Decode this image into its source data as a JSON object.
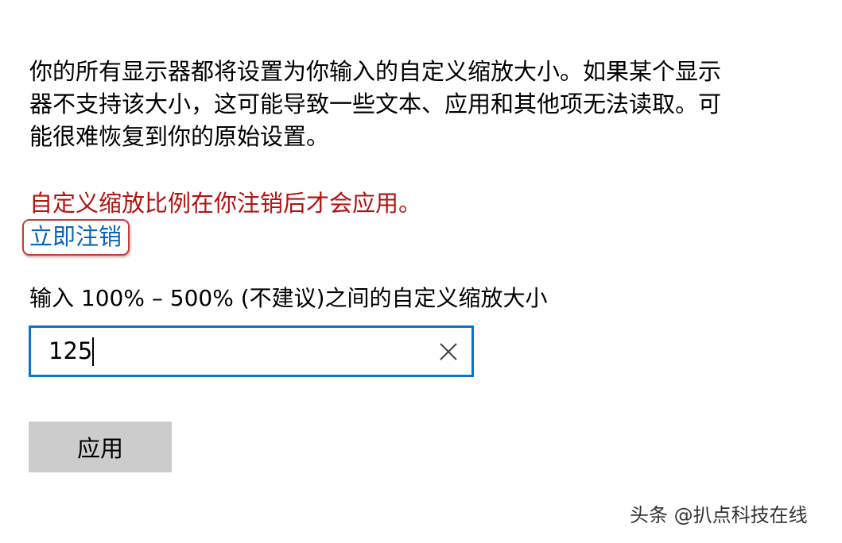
{
  "description": "你的所有显示器都将设置为你输入的自定义缩放大小。如果某个显示器不支持该大小，这可能导致一些文本、应用和其他项无法读取。可能很难恢复到你的原始设置。",
  "warning": "自定义缩放比例在你注销后才会应用。",
  "signout_link": "立即注销",
  "range_label": "输入 100% – 500% (不建议)之间的自定义缩放大小",
  "scale_input": {
    "value": "125"
  },
  "clear_icon": "close-icon",
  "apply_button": "应用",
  "watermark": "头条 @扒点科技在线",
  "colors": {
    "warning": "#b31212",
    "link": "#0a63b8",
    "input_border": "#0a73d0",
    "button_bg": "#cccccc",
    "highlight_border": "#c83a3a"
  }
}
